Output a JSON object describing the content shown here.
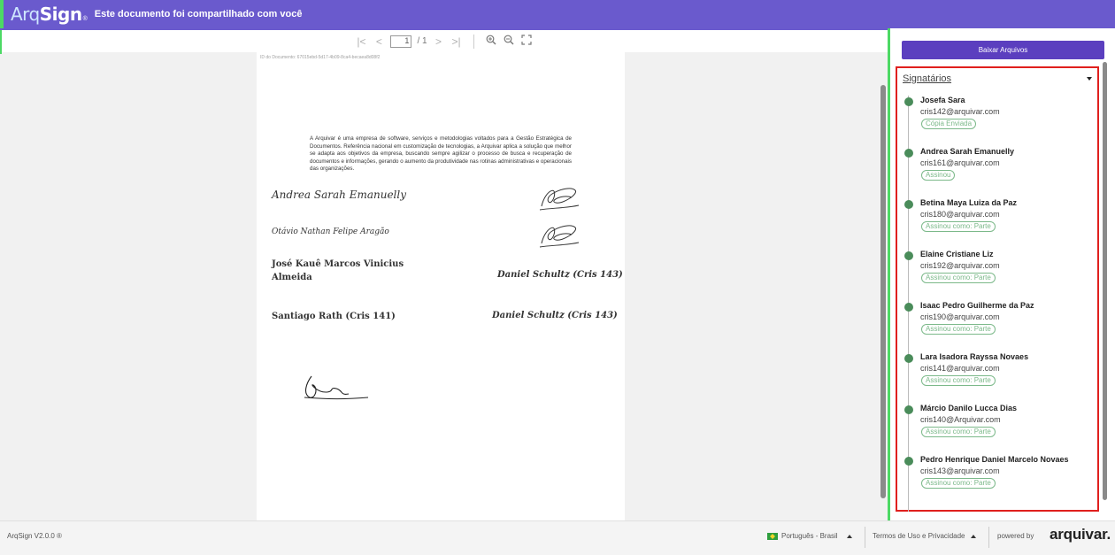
{
  "header": {
    "logo_arq": "Arq",
    "logo_sign": "Sign",
    "logo_tm": "®",
    "title": "Este documento foi compartilhado com você"
  },
  "viewer": {
    "toolbar": {
      "first_icon": "first-page-icon",
      "prev_icon": "previous-page-icon",
      "page_value": "1",
      "page_total": "/ 1",
      "next_icon": "next-page-icon",
      "last_icon": "last-page-icon",
      "zoom_in_icon": "zoom-in-icon",
      "zoom_out_icon": "zoom-out-icon",
      "fullscreen_icon": "fullscreen-icon"
    },
    "document": {
      "id_text": "ID do Documento: 67015ebd-5d17-4b09-8ca4-becaea8d08f2",
      "paragraph": "A Arquivar é uma empresa de software, serviços e metodologias voltados para a Gestão Estratégica de Documentos. Referência nacional em customização de tecnologias, a Arquivar aplica a solução que melhor se adapta aos objetivos da empresa, buscando sempre agilizar o processo de busca e recuperação de documentos e informações, gerando o aumento da produtividade nas rotinas administrativas e operacionais das organizações.",
      "signatures": {
        "sig1": "Andrea Sarah Emanuelly",
        "sig2": "Otávio Nathan Felipe Aragão",
        "sig3_line1": "José Kauê Marcos Vinicius",
        "sig3_line2": "Almeida",
        "sig4": "Daniel Schultz (Cris 143)",
        "sig5": "Santiago Rath (Cris 141)",
        "sig6": "Daniel Schultz (Cris 143)"
      }
    }
  },
  "panel": {
    "download_label": "Baixar Arquivos",
    "signers_title": "Signatários",
    "signers": [
      {
        "name": "Josefa Sara",
        "email": "cris142@arquivar.com",
        "status": "Cópia Enviada"
      },
      {
        "name": "Andrea Sarah Emanuelly",
        "email": "cris161@arquivar.com",
        "status": "Assinou"
      },
      {
        "name": "Betina Maya Luiza da Paz",
        "email": "cris180@arquivar.com",
        "status": "Assinou como: Parte"
      },
      {
        "name": "Elaine Cristiane Liz",
        "email": "cris192@arquivar.com",
        "status": "Assinou como: Parte"
      },
      {
        "name": "Isaac Pedro Guilherme da Paz",
        "email": "cris190@arquivar.com",
        "status": "Assinou como: Parte"
      },
      {
        "name": "Lara Isadora Rayssa Novaes",
        "email": "cris141@arquivar.com",
        "status": "Assinou como: Parte"
      },
      {
        "name": "Márcio Danilo Lucca Dias",
        "email": "cris140@Arquivar.com",
        "status": "Assinou como: Parte"
      },
      {
        "name": "Pedro Henrique Daniel Marcelo Novaes",
        "email": "cris143@arquivar.com",
        "status": "Assinou como: Parte"
      }
    ]
  },
  "footer": {
    "version": "ArqSign V2.0.0 ®",
    "language": "Português - Brasil",
    "terms": "Termos de Uso e Privacidade",
    "powered_by": "powered by",
    "brand": "arquivar."
  },
  "colors": {
    "header_bg": "#6a5acd",
    "accent_green": "#4cd964",
    "button_purple": "#5b3fbf",
    "highlight_red": "#e0201e",
    "status_green": "#7cb98a",
    "timeline_dot": "#4a8c5a"
  }
}
